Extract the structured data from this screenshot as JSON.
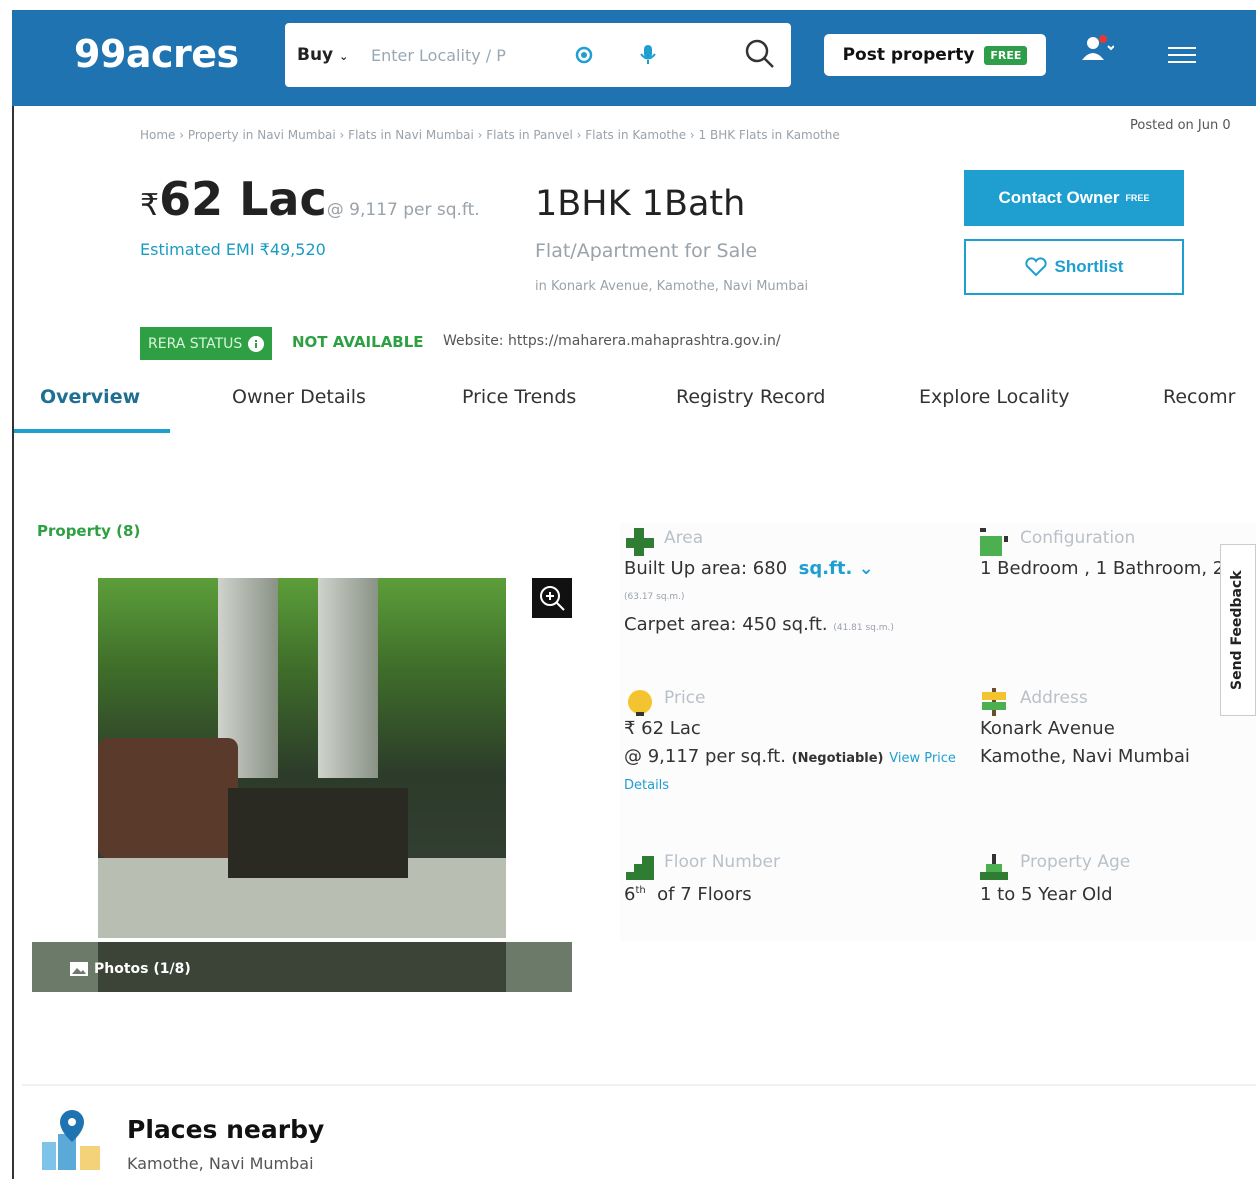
{
  "header": {
    "logo": "99acres",
    "buy_label": "Buy",
    "search_placeholder": "Enter Locality / P",
    "post_label": "Post property",
    "free_badge": "FREE"
  },
  "breadcrumb": "Home › Property in Navi Mumbai › Flats in Navi Mumbai › Flats in Panvel › Flats in Kamothe › 1 BHK Flats in Kamothe",
  "posted": "Posted on Jun 0",
  "listing": {
    "price_symbol": "₹",
    "price": "62 Lac",
    "per_sqft": "@ 9,117 per sq.ft.",
    "emi": "Estimated EMI ₹49,520",
    "bhk": "1BHK 1Bath",
    "type": "Flat/Apartment for Sale",
    "location": "in Konark Avenue, Kamothe, Navi Mumbai"
  },
  "actions": {
    "contact": "Contact Owner",
    "contact_free": "FREE",
    "shortlist": "Shortlist"
  },
  "rera": {
    "badge": "RERA STATUS",
    "status": "NOT AVAILABLE",
    "website": "Website: https://maharera.mahaprashtra.gov.in/"
  },
  "tabs": [
    "Overview",
    "Owner Details",
    "Price Trends",
    "Registry Record",
    "Explore Locality",
    "Recomr"
  ],
  "gallery": {
    "count": "Property (8)",
    "photos": "Photos (1/8)"
  },
  "details": {
    "area": {
      "label": "Area",
      "built_up": "Built Up area: 680",
      "unit": "sq.ft.",
      "built_up_sqm": "(63.17 sq.m.)",
      "carpet": "Carpet area: 450 sq.ft.",
      "carpet_sqm": "(41.81 sq.m.)"
    },
    "config": {
      "label": "Configuration",
      "value": "1 Bedroom , 1 Bathroom, 2"
    },
    "price": {
      "label": "Price",
      "value": "₹ 62 Lac",
      "per_sqft": "@ 9,117 per sq.ft.",
      "negotiable": "(Negotiable)",
      "link": "View Price",
      "link2": "Details"
    },
    "address": {
      "label": "Address",
      "line1": "Konark Avenue",
      "line2": "Kamothe, Navi Mumbai"
    },
    "floor": {
      "label": "Floor Number",
      "floor": "6",
      "sup": "th",
      "of": "of 7 Floors"
    },
    "age": {
      "label": "Property Age",
      "value": "1 to 5 Year Old"
    }
  },
  "feedback": "Send Feedback",
  "nearby": {
    "title": "Places nearby",
    "subtitle": "Kamothe, Navi Mumbai"
  }
}
